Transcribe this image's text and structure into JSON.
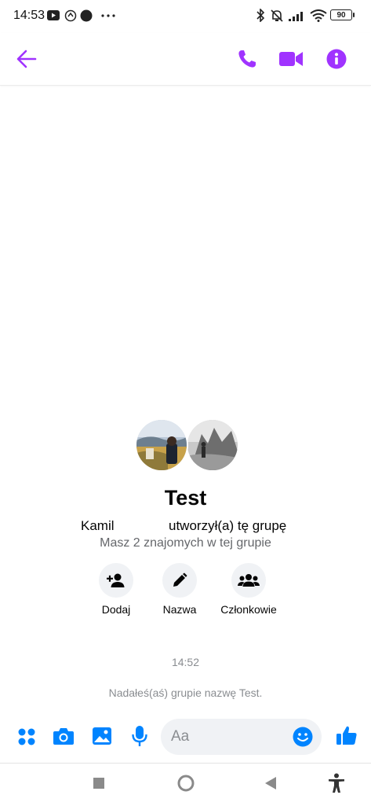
{
  "status_bar": {
    "time": "14:53",
    "battery": "90",
    "icons": [
      "youtube-icon",
      "sync-icon",
      "record-icon",
      "more-dots-icon",
      "bluetooth-icon",
      "mute-icon",
      "signal-icon",
      "wifi-icon",
      "battery-icon"
    ]
  },
  "header": {
    "icons": [
      "back-arrow-icon",
      "phone-icon",
      "video-icon",
      "info-icon"
    ],
    "accent": "#a033ff"
  },
  "group": {
    "name": "Test",
    "creator": "Kamil",
    "created_text": "utworzył(a) tę grupę",
    "mutual_friends": "Masz 2 znajomych w tej grupie"
  },
  "actions": [
    {
      "label": "Dodaj",
      "icon": "add-person-icon"
    },
    {
      "label": "Nazwa",
      "icon": "pencil-icon"
    },
    {
      "label": "Członkowie",
      "icon": "people-icon"
    }
  ],
  "messages": {
    "timestamp": "14:52",
    "system_message": "Nadałeś(aś) grupie nazwę Test."
  },
  "composer": {
    "placeholder": "Aa",
    "icons": [
      "apps-grid-icon",
      "camera-icon",
      "image-icon",
      "mic-icon",
      "emoji-icon",
      "like-icon"
    ],
    "blue": "#0084ff"
  },
  "nav": {
    "icons": [
      "square-recents-icon",
      "circle-home-icon",
      "triangle-back-icon",
      "accessibility-icon"
    ]
  }
}
